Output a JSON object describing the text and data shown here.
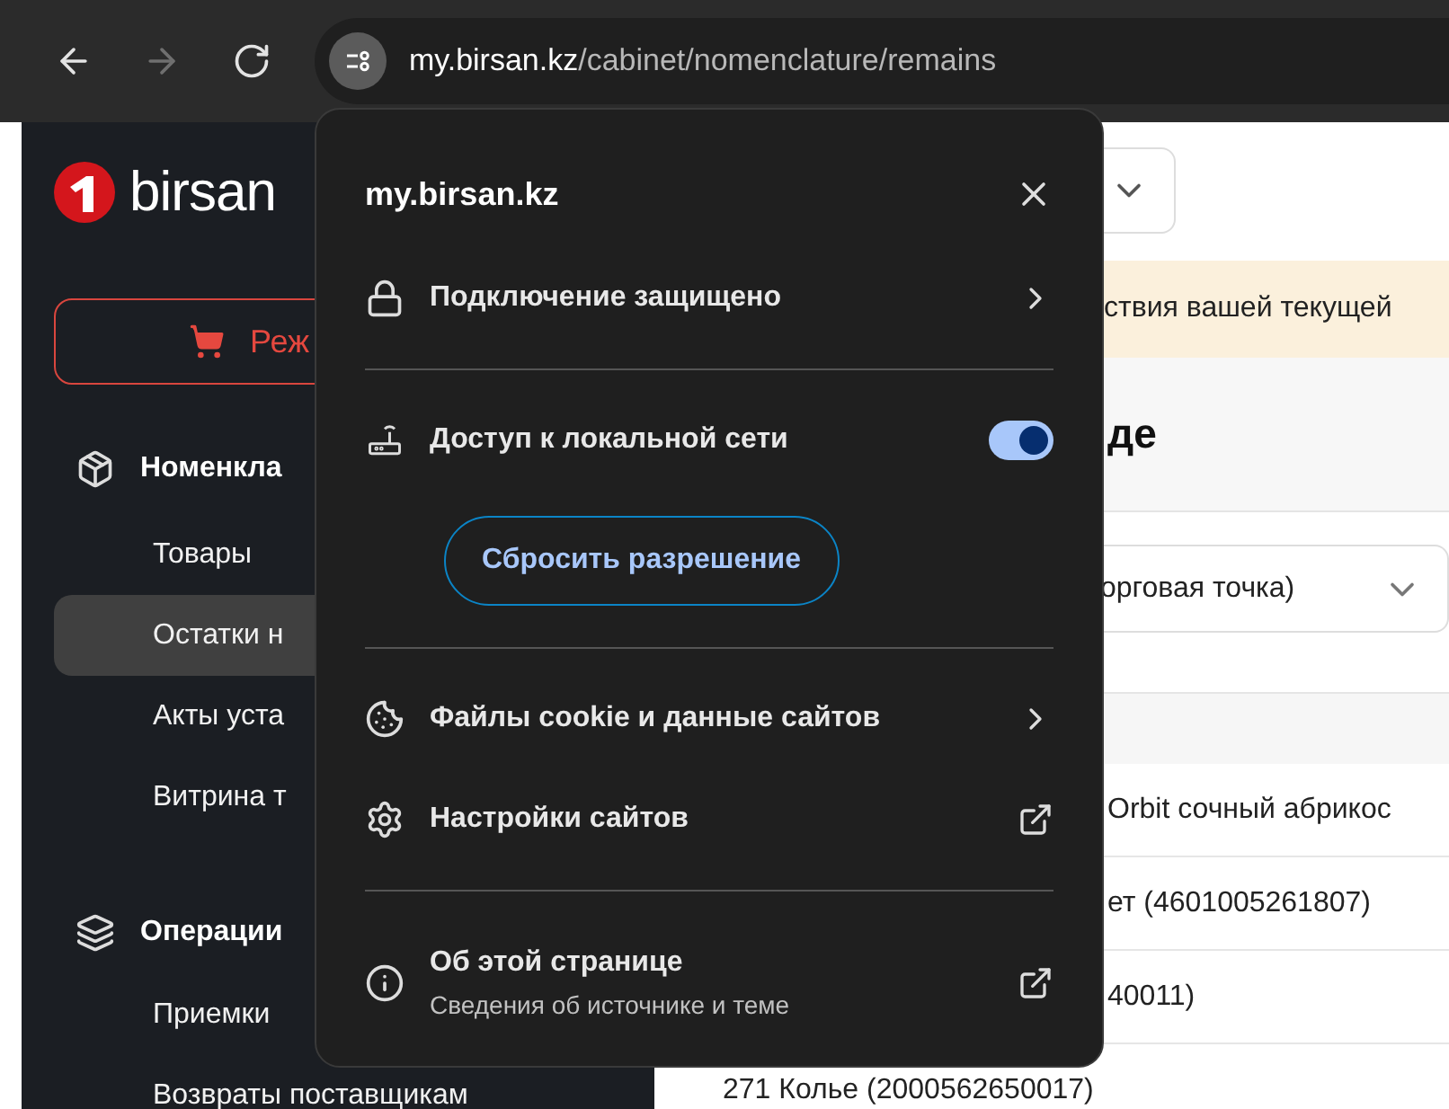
{
  "browser": {
    "nav": [
      {
        "kind": "back",
        "disabled": false
      },
      {
        "kind": "forward",
        "disabled": true
      },
      {
        "kind": "reload",
        "disabled": false
      }
    ],
    "url": {
      "host": "my.birsan.kz",
      "path": "/cabinet/nomenclature/remains"
    }
  },
  "sidebar": {
    "logo": "birsan",
    "cta": "Реж",
    "sections": [
      {
        "title": "Номенкла",
        "items": [
          {
            "label": "Товары",
            "selected": false
          },
          {
            "label": "Остатки н",
            "selected": true
          },
          {
            "label": "Акты уста",
            "selected": false
          },
          {
            "label": "Витрина т",
            "selected": false
          }
        ]
      },
      {
        "title": "Операции",
        "items": [
          {
            "label": "Приемки",
            "selected": false
          },
          {
            "label": "Возвраты поставщикам",
            "selected": false
          }
        ]
      }
    ]
  },
  "main": {
    "banner": "ствия вашей текущей",
    "heading": "де",
    "filter": "орговая точка)",
    "rows": [
      "Orbit сочный абрикос",
      "ет (4601005261807)",
      "40011)",
      "271 Колье (2000562650017)"
    ]
  },
  "popup": {
    "title": "my.birsan.kz",
    "groups": [
      [
        {
          "kind": "submenu",
          "label": "Подключение защищено"
        }
      ],
      [
        {
          "kind": "toggle",
          "label": "Доступ к локальной сети",
          "on": true,
          "button": "Сбросить разрешение"
        }
      ],
      [
        {
          "kind": "submenu",
          "label": "Файлы cookie и данные сайтов"
        },
        {
          "kind": "external",
          "label": "Настройки сайтов"
        }
      ],
      [
        {
          "kind": "external",
          "label": "Об этой странице",
          "sub": "Сведения об источнике и теме"
        }
      ]
    ]
  }
}
